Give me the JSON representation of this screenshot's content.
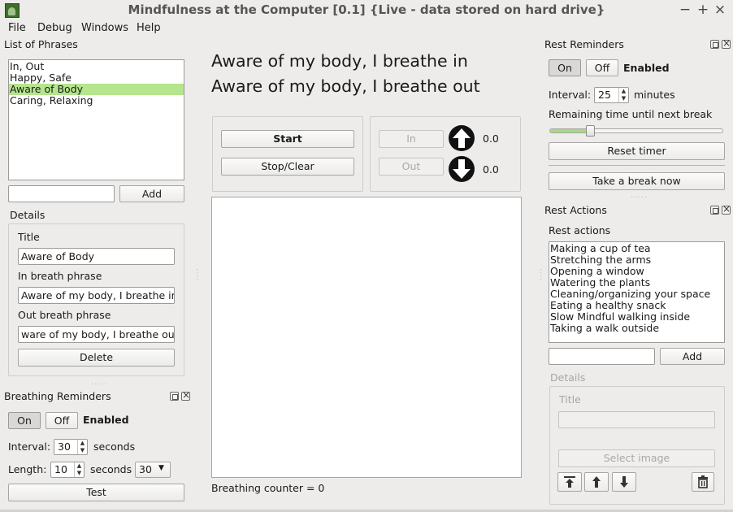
{
  "window": {
    "title": "Mindfulness at the Computer [0.1] {Live - data stored on hard drive}",
    "controls": {
      "minimize": "−",
      "maximize": "+",
      "close": "×"
    }
  },
  "menu": {
    "file": "File",
    "debug": "Debug",
    "windows": "Windows",
    "help": "Help"
  },
  "phrases": {
    "header": "List of Phrases",
    "items": [
      {
        "label": "In, Out",
        "selected": false
      },
      {
        "label": "Happy, Safe",
        "selected": false
      },
      {
        "label": "Aware of Body",
        "selected": true
      },
      {
        "label": "Caring, Relaxing",
        "selected": false
      }
    ],
    "new_phrase_value": "",
    "add_label": "Add",
    "details_header": "Details",
    "title_label": "Title",
    "title_value": "Aware of Body",
    "in_label": "In breath phrase",
    "in_value": "Aware of my body, I breathe in",
    "out_label": "Out breath phrase",
    "out_value": "ware of my body, I breathe out",
    "delete_label": "Delete"
  },
  "breathing_reminders": {
    "header": "Breathing Reminders",
    "on_label": "On",
    "off_label": "Off",
    "status": "Enabled",
    "interval_label": "Interval:",
    "interval_value": "30",
    "interval_unit": "seconds",
    "length_label": "Length:",
    "length_value": "10",
    "length_unit": "seconds",
    "length_combo_value": "30",
    "test_label": "Test"
  },
  "center": {
    "phrase_line1": "Aware of my body, I breathe in",
    "phrase_line2": "Aware of my body, I breathe out",
    "start_label": "Start",
    "stop_label": "Stop/Clear",
    "in_label": "In",
    "in_value": "0.0",
    "out_label": "Out",
    "out_value": "0.0",
    "counter_text": "Breathing counter = 0"
  },
  "rest_reminders": {
    "header": "Rest Reminders",
    "on_label": "On",
    "off_label": "Off",
    "status": "Enabled",
    "interval_label": "Interval:",
    "interval_value": "25",
    "interval_unit": "minutes",
    "remaining_label": "Remaining time until next break",
    "remaining_fraction": 0.22,
    "reset_label": "Reset timer",
    "break_label": "Take a break now"
  },
  "rest_actions": {
    "header": "Rest Actions",
    "list_label": "Rest actions",
    "items": [
      "Making a cup of tea",
      "Stretching the arms",
      "Opening a window",
      "Watering the plants",
      "Cleaning/organizing your space",
      "Eating a healthy snack",
      "Slow Mindful walking inside",
      "Taking a walk outside"
    ],
    "new_action_value": "",
    "add_label": "Add",
    "details_header": "Details",
    "title_label": "Title",
    "select_image_label": "Select image"
  },
  "colors": {
    "background": "#edeceb",
    "selection": "#b5e58d",
    "slider_fill": "#a6d98a"
  }
}
